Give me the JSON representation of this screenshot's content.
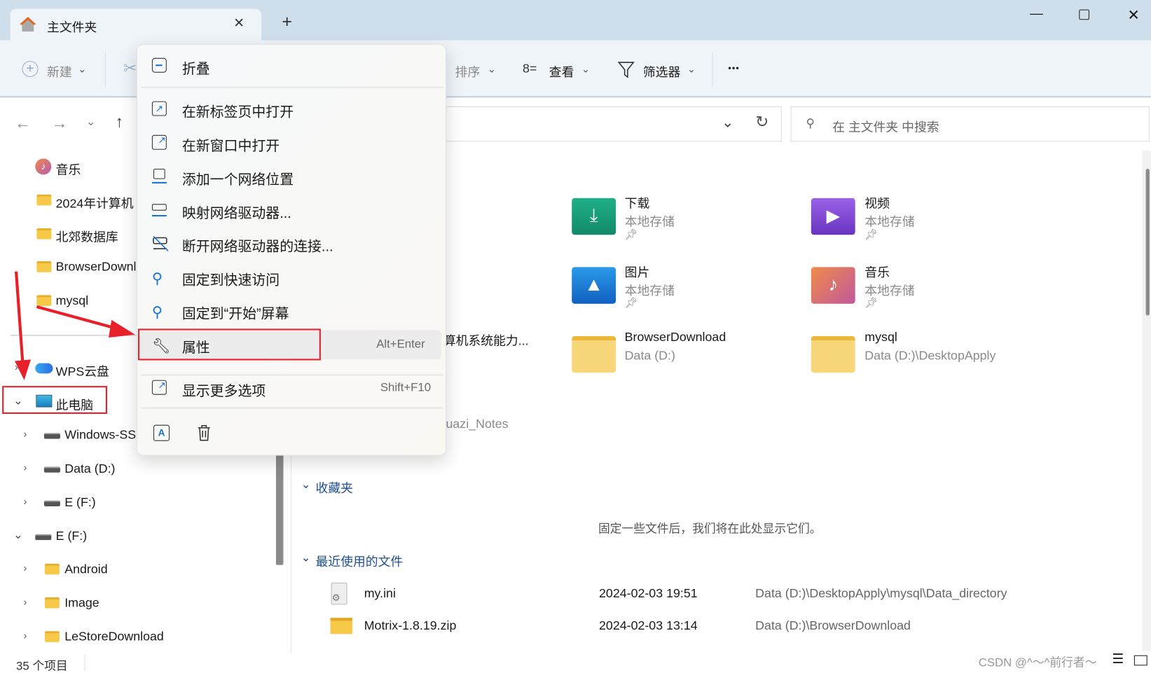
{
  "window": {
    "tab_title": "主文件夹",
    "new_tab": "+",
    "controls": {
      "minimize": "—",
      "maximize": "☐",
      "close": "✕"
    }
  },
  "toolbar": {
    "new_label": "新建",
    "sort_label": "排序",
    "view_label": "查看",
    "filter_label": "筛选器",
    "more_label": "•••"
  },
  "search": {
    "placeholder": "在 主文件夹 中搜索"
  },
  "nav": {
    "pinned": [
      {
        "label": "音乐",
        "icon": "music-icon"
      },
      {
        "label": "2024年计算机",
        "icon": "folder-icon"
      },
      {
        "label": "北郊数据库",
        "icon": "folder-icon"
      },
      {
        "label": "BrowserDownl",
        "icon": "folder-icon"
      },
      {
        "label": "mysql",
        "icon": "folder-icon"
      }
    ],
    "tree": [
      {
        "label": "WPS云盘",
        "icon": "cloud-icon",
        "expanded": false
      },
      {
        "label": "此电脑",
        "icon": "monitor-icon",
        "expanded": true
      },
      {
        "label": "Windows-SS",
        "icon": "drive-icon"
      },
      {
        "label": "Data (D:)",
        "icon": "drive-icon"
      },
      {
        "label": "E (F:)",
        "icon": "drive-icon"
      },
      {
        "label": "E (F:)",
        "icon": "drive-icon",
        "expanded": true
      },
      {
        "label": "Android",
        "icon": "folder-icon"
      },
      {
        "label": "Image",
        "icon": "folder-icon"
      },
      {
        "label": "LeStoreDownload",
        "icon": "folder-icon"
      }
    ]
  },
  "quick_access": [
    {
      "name": "下载",
      "sub": "本地存储",
      "pinned": true,
      "color": "#1aa37a"
    },
    {
      "name": "视频",
      "sub": "本地存储",
      "pinned": true,
      "color": "#8a4fd8"
    },
    {
      "name": "图片",
      "sub": "本地存储",
      "pinned": true,
      "color": "#1a7fd6"
    },
    {
      "name": "音乐",
      "sub": "本地存储",
      "pinned": true,
      "color": "#e0704a"
    },
    {
      "name": "算机系统能力...",
      "sub": ""
    },
    {
      "name": "BrowserDownload",
      "sub": "Data (D:)"
    },
    {
      "name": "mysql",
      "sub": "Data (D:)\\DesktopApply"
    },
    {
      "name": "huazi_Notes",
      "sub": ""
    }
  ],
  "favorites": {
    "title": "收藏夹",
    "empty_text": "固定一些文件后，我们将在此处显示它们。"
  },
  "recent": {
    "title": "最近使用的文件",
    "files": [
      {
        "name": "my.ini",
        "date": "2024-02-03 19:51",
        "path": "Data (D:)\\DesktopApply\\mysql\\Data_directory"
      },
      {
        "name": "Motrix-1.8.19.zip",
        "date": "2024-02-03 13:14",
        "path": "Data (D:)\\BrowserDownload"
      }
    ]
  },
  "status": {
    "count": "35 个项目"
  },
  "watermark": "CSDN @^～^前行者～",
  "context_menu": {
    "items": [
      {
        "label": "折叠",
        "icon": "collapse-icon"
      },
      {
        "label": "在新标签页中打开",
        "icon": "open-new-tab-icon"
      },
      {
        "label": "在新窗口中打开",
        "icon": "open-new-window-icon"
      },
      {
        "label": "添加一个网络位置",
        "icon": "network-location-icon"
      },
      {
        "label": "映射网络驱动器...",
        "icon": "map-drive-icon"
      },
      {
        "label": "断开网络驱动器的连接...",
        "icon": "disconnect-drive-icon"
      },
      {
        "label": "固定到快速访问",
        "icon": "pin-icon"
      },
      {
        "label": "固定到“开始”屏幕",
        "icon": "pin-icon"
      },
      {
        "label": "属性",
        "icon": "wrench-icon",
        "shortcut": "Alt+Enter",
        "highlighted": true
      },
      {
        "label": "显示更多选项",
        "icon": "more-options-icon",
        "shortcut": "Shift+F10"
      }
    ]
  },
  "colors": {
    "annotation": "#e8202a",
    "accent": "#1f4f8f",
    "titlebar": "#cfdeeb"
  }
}
